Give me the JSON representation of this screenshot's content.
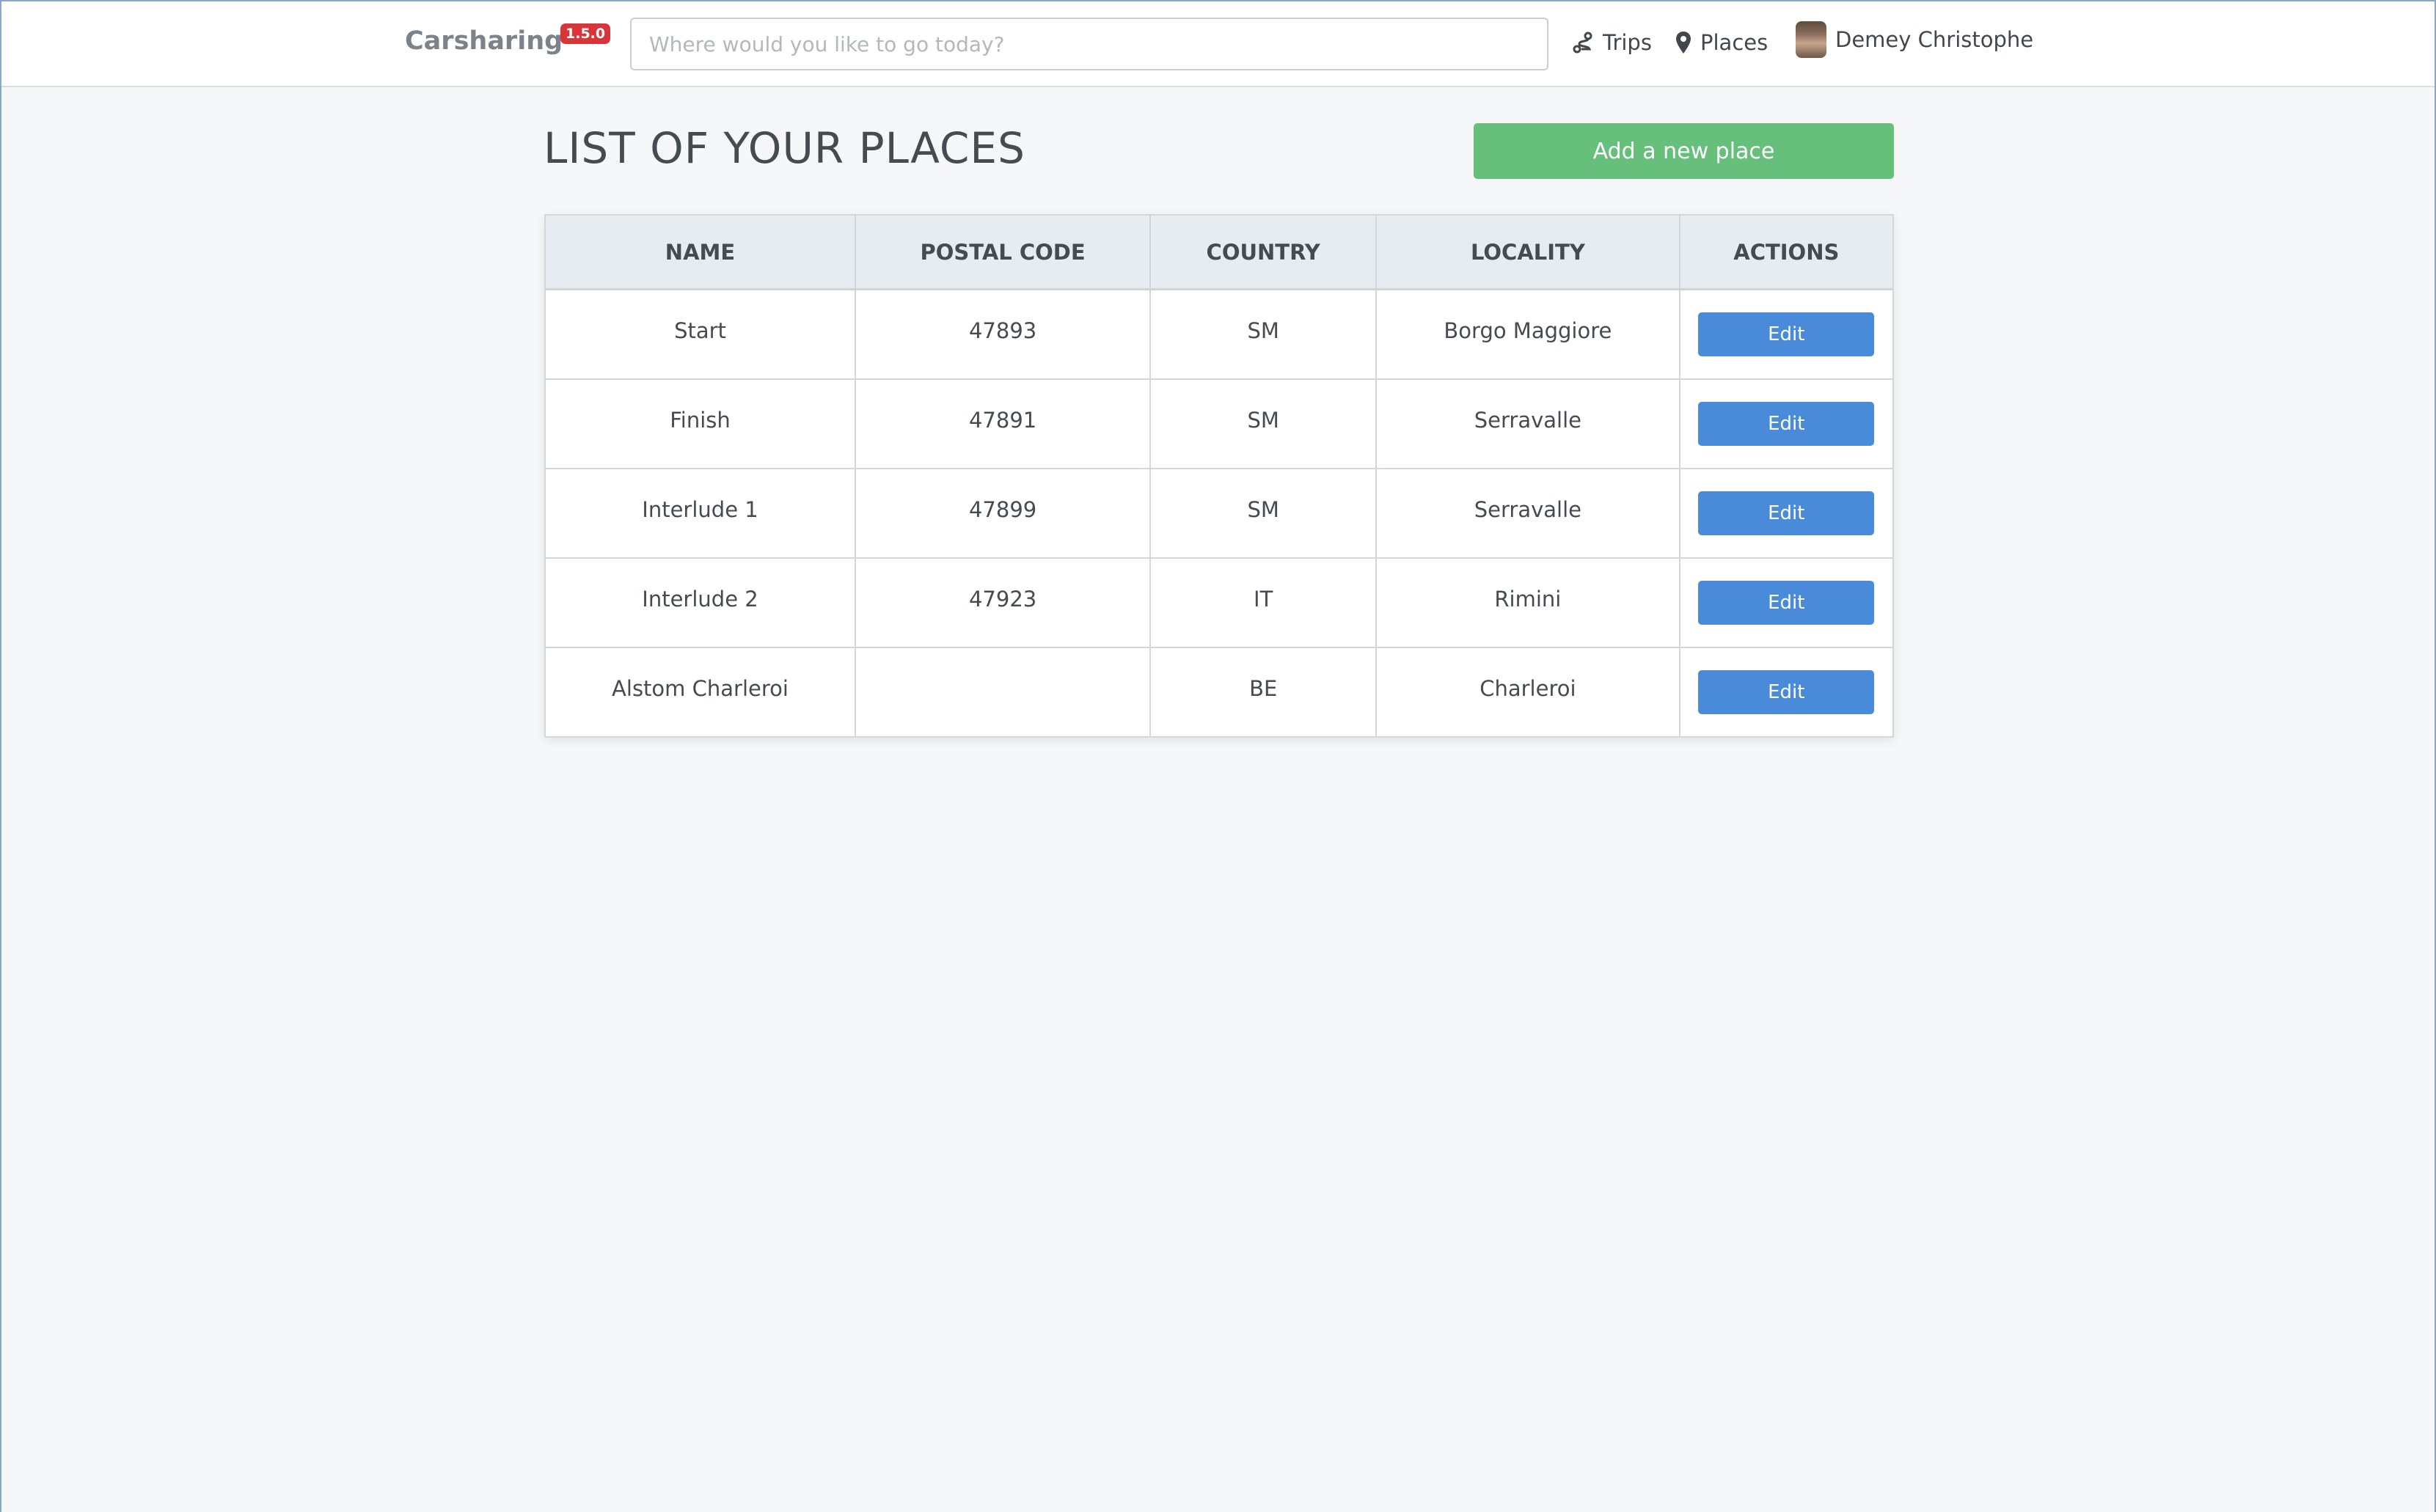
{
  "navbar": {
    "brand": "Carsharing",
    "version": "1.5.0",
    "search_placeholder": "Where would you like to go today?",
    "links": {
      "trips": "Trips",
      "places": "Places",
      "user": "Demey Christophe"
    }
  },
  "page": {
    "title": "LIST OF YOUR PLACES",
    "add_button": "Add a new place"
  },
  "table": {
    "headers": {
      "name": "NAME",
      "postal_code": "POSTAL CODE",
      "country": "COUNTRY",
      "locality": "LOCALITY",
      "actions": "ACTIONS"
    },
    "rows": [
      {
        "name": "Start",
        "postal_code": "47893",
        "country": "SM",
        "locality": "Borgo Maggiore",
        "action": "Edit"
      },
      {
        "name": "Finish",
        "postal_code": "47891",
        "country": "SM",
        "locality": "Serravalle",
        "action": "Edit"
      },
      {
        "name": "Interlude 1",
        "postal_code": "47899",
        "country": "SM",
        "locality": "Serravalle",
        "action": "Edit"
      },
      {
        "name": "Interlude 2",
        "postal_code": "47923",
        "country": "IT",
        "locality": "Rimini",
        "action": "Edit"
      },
      {
        "name": "Alstom Charleroi",
        "postal_code": "",
        "country": "BE",
        "locality": "Charleroi",
        "action": "Edit"
      }
    ]
  },
  "icons": {
    "trips": "route-icon",
    "places": "map-marker-icon",
    "user": "avatar"
  },
  "colors": {
    "brand_badge": "#d8353a",
    "primary_button": "#66c07b",
    "edit_button": "#4a8bd9",
    "background": "#f5f7f9"
  }
}
